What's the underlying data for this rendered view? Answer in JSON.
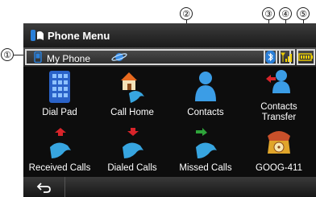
{
  "title_bar": {
    "title": "Phone Menu",
    "icon": "phone-book-icon"
  },
  "status_bar": {
    "device_name": "My Phone",
    "device_icon": "mobile-phone-icon",
    "connection_icon": "planet-icon",
    "bluetooth_icon": "bluetooth-icon",
    "signal_icon": "signal-strength-icon",
    "battery_icon": "battery-icon"
  },
  "callouts": [
    "①",
    "②",
    "③",
    "④",
    "⑤"
  ],
  "menu": {
    "dial_pad": "Dial Pad",
    "call_home": "Call Home",
    "contacts": "Contacts",
    "contacts_transfer_1": "Contacts",
    "contacts_transfer_2": "Transfer",
    "received_calls": "Received Calls",
    "dialed_calls": "Dialed Calls",
    "missed_calls": "Missed Calls",
    "goog411": "GOOG-411"
  },
  "bottom_bar": {
    "back_icon": "back-arrow-icon"
  },
  "colors": {
    "accent_blue": "#2a7fd8",
    "battery_yellow": "#f0d000",
    "arrow_red": "#d8242a",
    "arrow_green": "#2ea43a"
  }
}
